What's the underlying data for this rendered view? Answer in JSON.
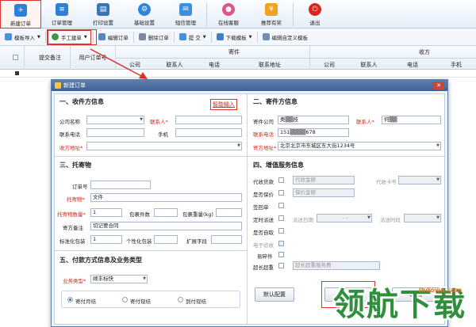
{
  "ribbon": {
    "items": [
      {
        "label": "新建订单",
        "icon": "new-order-icon",
        "color": "#2f7fd6"
      },
      {
        "label": "订单管理",
        "icon": "order-list-icon",
        "color": "#2f7fd6"
      },
      {
        "label": "打印设置",
        "icon": "printer-icon",
        "color": "#3a76b5"
      },
      {
        "label": "基础设置",
        "icon": "gear-icon",
        "color": "#2e86d8"
      },
      {
        "label": "短信管理",
        "icon": "mail-icon",
        "color": "#3a8fe0"
      },
      {
        "label": "在线客服",
        "icon": "chat-icon",
        "color": "#e0568a"
      },
      {
        "label": "推荐有奖",
        "icon": "gift-icon",
        "color": "#f2a21e"
      },
      {
        "label": "退出",
        "icon": "power-icon",
        "color": "#d8261c"
      }
    ]
  },
  "toolbar": {
    "template_import": "模板导入",
    "manual_entry": "手工建单",
    "edit_order": "编辑订单",
    "delete_order": "删除订单",
    "submit": "提 交",
    "download_template": "下载模板",
    "edit_custom_template": "编辑自定义模板"
  },
  "grid": {
    "group_sender": "寄件",
    "group_receiver": "收方",
    "columns": [
      "提交备注",
      "用户订单号",
      "公司",
      "联系人",
      "电话",
      "联系地址",
      "公司",
      "联系人",
      "电话",
      "手机"
    ]
  },
  "dialog": {
    "title": "新建订单",
    "close": "✕",
    "receiver": {
      "heading": "一、收件方信息",
      "smart_input": "智能输入",
      "company_label": "公司名称",
      "contact_label": "联系人*",
      "phone_label": "联系电话",
      "mobile_label": "手机",
      "address_label": "收方地址*"
    },
    "sender": {
      "heading": "二、寄件方信息",
      "company_label": "寄件公司",
      "company_value": "奥▒▒技",
      "contact_label": "联系人*",
      "contact_value": "何▒▒",
      "phone_label": "联系电话",
      "phone_value": "151▒▒▒▒678",
      "address_label": "寄方地址*",
      "address_value": "北京北京市东城区东大街1234号"
    },
    "goods": {
      "heading": "三、托寄物",
      "order_no_label": "订单号",
      "goods_label": "托寄物*",
      "goods_value": "文件",
      "qty_label": "托寄物数量*",
      "qty_value": "1",
      "packages_label": "包裹件数",
      "weight_label": "包裹重量(kg)",
      "remark_label": "寄方备注",
      "remark_value": "切记要合同",
      "std_pack_label": "标准化包装",
      "std_pack_value": "1",
      "custom_pack_label": "个性化包装",
      "ext_label": "扩展字段"
    },
    "payment": {
      "heading": "五、付款方式信息及业务类型",
      "biz_type_label": "业务类型*",
      "biz_type_value": "顺丰标快",
      "options": [
        "寄付月结",
        "寄付现结",
        "到付现结"
      ]
    },
    "services": {
      "heading": "四、增值服务信息",
      "cod_label": "代收货款",
      "cod_amount": "代收金额",
      "cod_card": "代收卡号",
      "insured_label": "是否保价",
      "insured_amount": "保价金额",
      "receipt_label": "签回单",
      "scheduled_label": "定时派送",
      "scheduled_date": "派送日期",
      "date_placeholder": "- -",
      "scheduled_time": "派送时段",
      "pickup_label": "是否自取",
      "e_receipt_label": "电子验收",
      "easy_break_label": "易碎件",
      "oversize_label": "超长超重",
      "oversize_fee": "超长超重服务费"
    },
    "default_config": "默认配置",
    "confirm": "确 定",
    "cancel": "取 消"
  },
  "watermark": {
    "brand": "领航下载",
    "url": "lhdown.com"
  }
}
